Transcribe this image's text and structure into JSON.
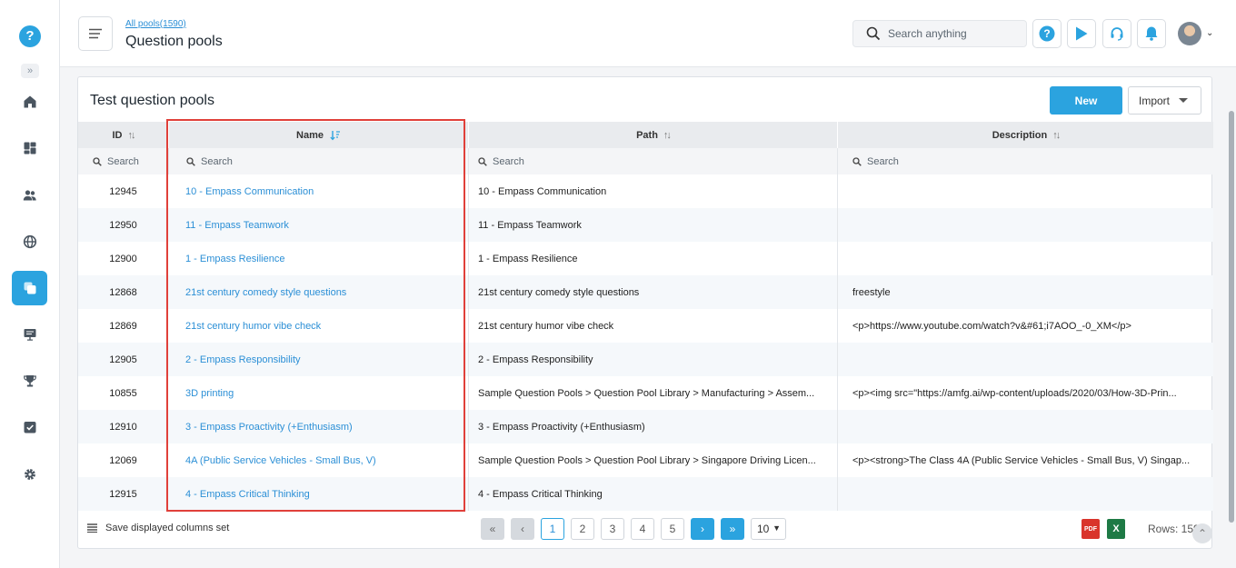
{
  "sidebar": {
    "logo_glyph": "?",
    "items": [
      {
        "name": "home-icon"
      },
      {
        "name": "dashboard-icon"
      },
      {
        "name": "users-icon"
      },
      {
        "name": "globe-icon"
      },
      {
        "name": "question-pools-icon",
        "active": true
      },
      {
        "name": "presentation-icon"
      },
      {
        "name": "trophy-icon"
      },
      {
        "name": "tasks-icon"
      },
      {
        "name": "settings-icon"
      }
    ]
  },
  "header": {
    "breadcrumb": "All pools(1590)",
    "title": "Question pools",
    "search_placeholder": "Search anything"
  },
  "card": {
    "title": "Test question pools",
    "new_label": "New",
    "import_label": "Import"
  },
  "table": {
    "columns": [
      "ID",
      "Name",
      "Path",
      "Description"
    ],
    "search_placeholder": "Search",
    "rows": [
      {
        "id": "12945",
        "name": "10 - Empass Communication",
        "path": "10 - Empass Communication",
        "desc": ""
      },
      {
        "id": "12950",
        "name": "11 - Empass Teamwork",
        "path": "11 - Empass Teamwork",
        "desc": ""
      },
      {
        "id": "12900",
        "name": "1 - Empass Resilience",
        "path": "1 - Empass Resilience",
        "desc": ""
      },
      {
        "id": "12868",
        "name": "21st century comedy style questions",
        "path": "21st century comedy style questions",
        "desc": "freestyle"
      },
      {
        "id": "12869",
        "name": "21st century humor vibe check",
        "path": "21st century humor vibe check",
        "desc": "<p>https://www.youtube.com/watch?v&#61;i7AOO_-0_XM</p>"
      },
      {
        "id": "12905",
        "name": "2 - Empass Responsibility",
        "path": "2 - Empass Responsibility",
        "desc": ""
      },
      {
        "id": "10855",
        "name": "3D printing",
        "path": "Sample Question Pools > Question Pool Library > Manufacturing > Assem...",
        "desc": "<p><img src=\"https://amfg.ai/wp-content/uploads/2020/03/How-3D-Prin..."
      },
      {
        "id": "12910",
        "name": "3 - Empass Proactivity (+Enthusiasm)",
        "path": "3 - Empass Proactivity (+Enthusiasm)",
        "desc": ""
      },
      {
        "id": "12069",
        "name": "4A (Public Service Vehicles - Small Bus, V)",
        "path": "Sample Question Pools > Question Pool Library > Singapore Driving Licen...",
        "desc": "<p><strong>The Class 4A (Public Service Vehicles - Small Bus, V) Singap..."
      },
      {
        "id": "12915",
        "name": "4 - Empass Critical Thinking",
        "path": "4 - Empass Critical Thinking",
        "desc": ""
      }
    ]
  },
  "footer": {
    "save_columns": "Save displayed columns set",
    "pages": [
      "1",
      "2",
      "3",
      "4",
      "5"
    ],
    "current_page": "1",
    "page_size": "10",
    "rows_label": "Rows: 1590",
    "pdf_label": "PDF",
    "excel_label": "X"
  },
  "colors": {
    "accent": "#2ba3df",
    "link": "#2b8fd6",
    "highlight": "#e0403a"
  }
}
